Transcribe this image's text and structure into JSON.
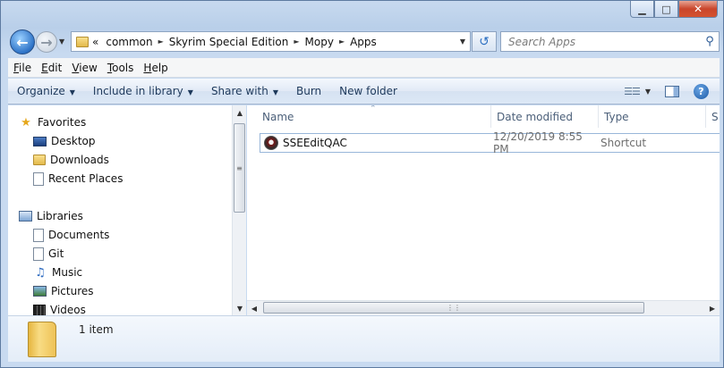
{
  "window": {
    "caption_buttons": {
      "minimize": "▁",
      "maximize": "□",
      "close": "✕"
    }
  },
  "address": {
    "overflow": "«",
    "segments": [
      "common",
      "Skyrim Special Edition",
      "Mopy",
      "Apps"
    ],
    "separator": "►"
  },
  "search": {
    "placeholder": "Search Apps"
  },
  "menu": [
    {
      "key": "F",
      "rest": "ile"
    },
    {
      "key": "E",
      "rest": "dit"
    },
    {
      "key": "V",
      "rest": "iew"
    },
    {
      "key": "T",
      "rest": "ools"
    },
    {
      "key": "H",
      "rest": "elp"
    }
  ],
  "commands": {
    "organize": "Organize",
    "include_in_library": "Include in library",
    "share_with": "Share with",
    "burn": "Burn",
    "new_folder": "New folder",
    "help_glyph": "?"
  },
  "nav": {
    "favorites": {
      "label": "Favorites",
      "items": [
        "Desktop",
        "Downloads",
        "Recent Places"
      ]
    },
    "libraries": {
      "label": "Libraries",
      "items": [
        "Documents",
        "Git",
        "Music",
        "Pictures",
        "Videos"
      ]
    }
  },
  "columns": {
    "name": "Name",
    "date_modified": "Date modified",
    "type": "Type",
    "size_partial": "S"
  },
  "files": [
    {
      "name": "SSEEditQAC",
      "date": "12/20/2019 8:55 PM",
      "type": "Shortcut"
    }
  ],
  "status": {
    "item_count": "1 item"
  },
  "icons": {
    "back": "back-arrow-icon",
    "forward": "forward-arrow-icon",
    "refresh": "refresh-icon",
    "search": "search-icon",
    "help": "help-icon"
  },
  "colors": {
    "accent": "#1e395b",
    "selection_border": "#98b6d9",
    "folder": "#f3cf68"
  }
}
